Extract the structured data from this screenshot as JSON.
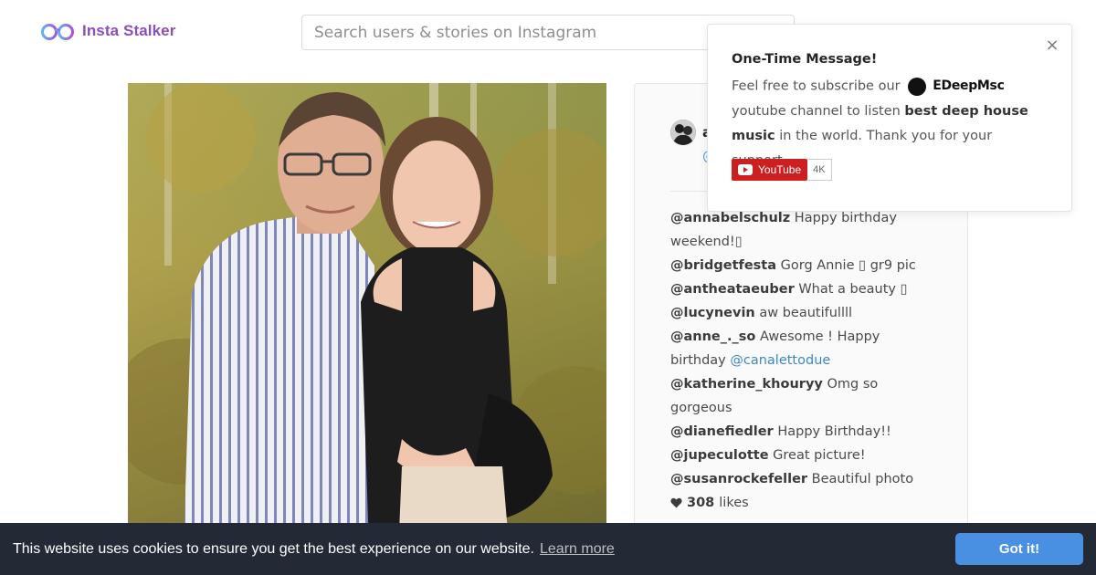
{
  "header": {
    "logo_text": "Insta Stalker",
    "search_placeholder": "Search users & stories on Instagram",
    "search_value": ""
  },
  "post": {
    "author_name": "a",
    "author_handle": "@",
    "comments": [
      {
        "user": "@annabelschulz",
        "text": "Happy birthday weekend!▯"
      },
      {
        "user": "@bridgetfesta",
        "text": "Gorg Annie ▯ gr9 pic"
      },
      {
        "user": "@antheataeuber",
        "text": "What a beauty ▯"
      },
      {
        "user": "@lucynevin",
        "text": "aw beautifullll"
      },
      {
        "user": "@anne_._so",
        "text": "Awesome ! Happy birthday",
        "mention": "@canalettodue"
      },
      {
        "user": "@katherine_khouryy",
        "text": "Omg so gorgeous"
      },
      {
        "user": "@dianefiedler",
        "text": "Happy Birthday!!"
      },
      {
        "user": "@jupeculotte",
        "text": "Great picture!"
      },
      {
        "user": "@susanrockefeller",
        "text": "Beautiful photo"
      }
    ],
    "likes_count": "308",
    "likes_label": "likes"
  },
  "popup": {
    "title": "One-Time Message!",
    "body_prefix": "Feel free to subscribe our",
    "channel_name": "EDeepMsc",
    "body_middle": "youtube channel to listen",
    "body_bold": "best deep house music",
    "body_suffix": "in the world. Thank you for your support.",
    "youtube_label": "YouTube",
    "subscriber_count": "4K",
    "close_symbol": "×"
  },
  "cookie": {
    "message": "This website uses cookies to ensure you get the best experience on our website.",
    "learn_more": "Learn more",
    "accept_label": "Got it!"
  },
  "colors": {
    "brand": "#8a4fb8",
    "link": "#3b88c3",
    "cookie_bg": "#232a36",
    "cookie_button": "#4a90e2",
    "youtube_red": "#cc1f1f"
  }
}
